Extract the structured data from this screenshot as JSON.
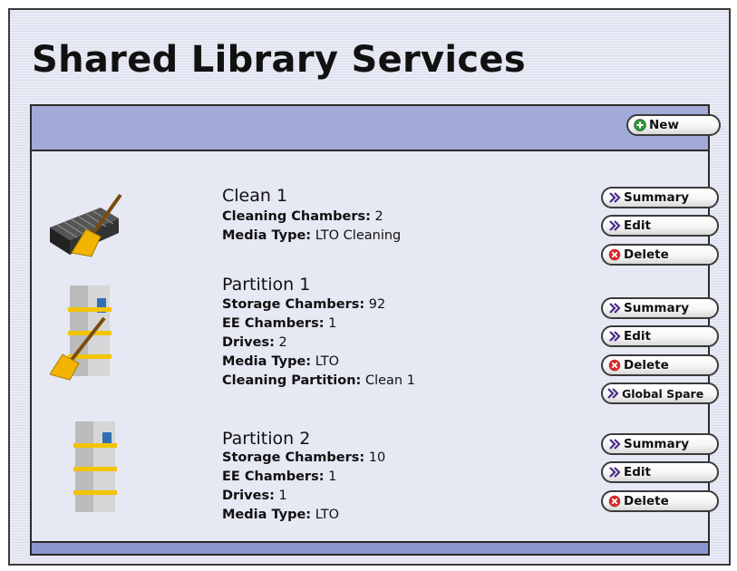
{
  "page": {
    "title": "Shared Library Services"
  },
  "toolbar": {
    "new_label": "New"
  },
  "entries": [
    {
      "name": "Clean 1",
      "details": [
        {
          "label": "Cleaning Chambers:",
          "value": "2"
        },
        {
          "label": "Media Type:",
          "value": "LTO Cleaning"
        }
      ],
      "actions": [
        "Summary",
        "Edit",
        "Delete"
      ]
    },
    {
      "name": "Partition 1",
      "details": [
        {
          "label": "Storage Chambers:",
          "value": "92"
        },
        {
          "label": "EE Chambers:",
          "value": "1"
        },
        {
          "label": "Drives:",
          "value": "2"
        },
        {
          "label": "Media Type:",
          "value": "LTO"
        },
        {
          "label": "Cleaning Partition:",
          "value": "Clean 1"
        }
      ],
      "actions": [
        "Summary",
        "Edit",
        "Delete",
        "Global Spare"
      ]
    },
    {
      "name": "Partition 2",
      "details": [
        {
          "label": "Storage Chambers:",
          "value": "10"
        },
        {
          "label": "EE Chambers:",
          "value": "1"
        },
        {
          "label": "Drives:",
          "value": "1"
        },
        {
          "label": "Media Type:",
          "value": "LTO"
        }
      ],
      "actions": [
        "Summary",
        "Edit",
        "Delete"
      ]
    }
  ],
  "icons": {
    "new": "plus-circle-icon",
    "summary": "double-chevron-icon",
    "edit": "double-chevron-icon",
    "delete": "x-circle-icon",
    "global_spare": "double-chevron-icon"
  },
  "colors": {
    "toolbar": "#a2abd8",
    "panel": "#e6e8f4",
    "chevron": "#4a2a8a",
    "delete": "#d42a2a",
    "new": "#2e9a3a"
  }
}
